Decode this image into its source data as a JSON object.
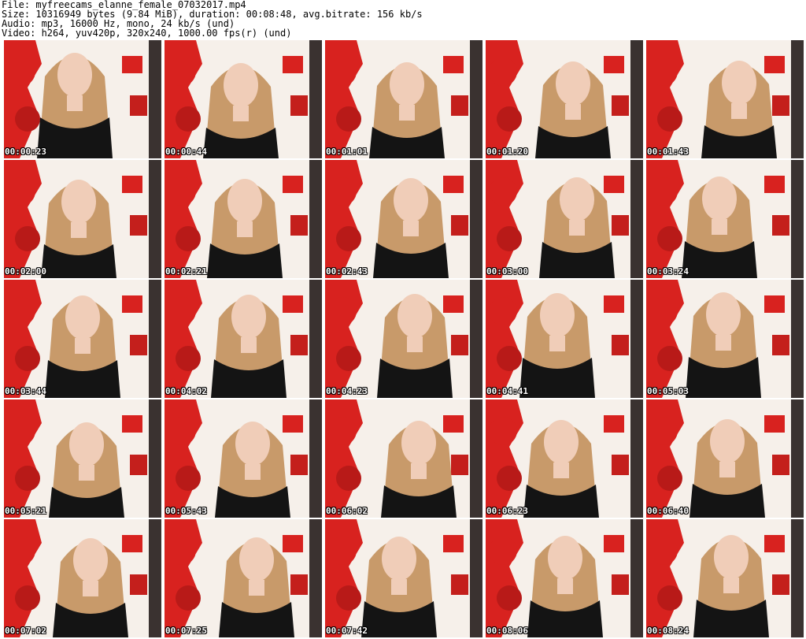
{
  "header": {
    "file": "File: myfreecams_elanne_female_07032017.mp4",
    "size": "Size: 10316949 bytes (9.84 MiB), duration: 00:08:48, avg.bitrate: 156 kb/s",
    "audio": "Audio: mp3, 16000 Hz, mono, 24 kb/s (und)",
    "video": "Video: h264, yuv420p, 320x240, 1000.00 fps(r) (und)"
  },
  "colors": {
    "background": "#ffffff",
    "wall_red": "#d8221f",
    "wall_white": "#f6f0ea",
    "hair": "#c89a6a",
    "top": "#141414",
    "skin": "#f0cdb8"
  },
  "thumbnails": [
    {
      "timestamp": "00:00:23"
    },
    {
      "timestamp": "00:00:44"
    },
    {
      "timestamp": "00:01:01"
    },
    {
      "timestamp": "00:01:20"
    },
    {
      "timestamp": "00:01:43"
    },
    {
      "timestamp": "00:02:00"
    },
    {
      "timestamp": "00:02:21"
    },
    {
      "timestamp": "00:02:43"
    },
    {
      "timestamp": "00:03:00"
    },
    {
      "timestamp": "00:03:24"
    },
    {
      "timestamp": "00:03:44"
    },
    {
      "timestamp": "00:04:02"
    },
    {
      "timestamp": "00:04:23"
    },
    {
      "timestamp": "00:04:41"
    },
    {
      "timestamp": "00:05:03"
    },
    {
      "timestamp": "00:05:21"
    },
    {
      "timestamp": "00:05:43"
    },
    {
      "timestamp": "00:06:02"
    },
    {
      "timestamp": "00:06:23"
    },
    {
      "timestamp": "00:06:40"
    },
    {
      "timestamp": "00:07:02"
    },
    {
      "timestamp": "00:07:25"
    },
    {
      "timestamp": "00:07:42"
    },
    {
      "timestamp": "00:08:06"
    },
    {
      "timestamp": "00:08:24"
    }
  ]
}
